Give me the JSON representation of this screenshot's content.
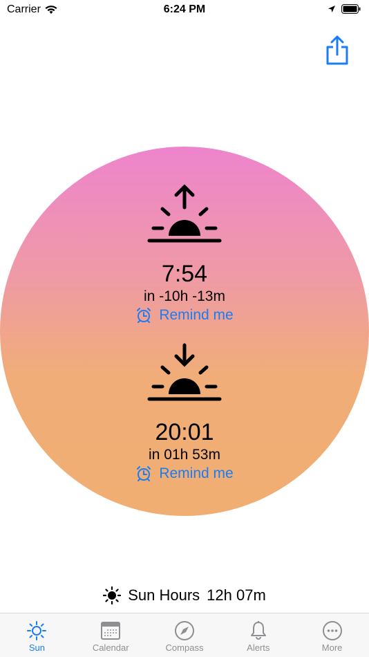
{
  "status": {
    "carrier": "Carrier",
    "time": "6:24 PM"
  },
  "sunrise": {
    "time": "7:54",
    "relative": "in -10h -13m",
    "remind_label": "Remind me"
  },
  "sunset": {
    "time": "20:01",
    "relative": "in 01h 53m",
    "remind_label": "Remind me"
  },
  "sun_hours": {
    "label": "Sun Hours",
    "value": "12h 07m"
  },
  "tabs": [
    {
      "label": "Sun",
      "icon": "sun-icon",
      "active": true
    },
    {
      "label": "Calendar",
      "icon": "calendar-icon"
    },
    {
      "label": "Compass",
      "icon": "compass-icon"
    },
    {
      "label": "Alerts",
      "icon": "bell-icon"
    },
    {
      "label": "More",
      "icon": "more-icon"
    }
  ],
  "colors": {
    "accent": "#1a7cf5",
    "gradient_top": "#ee84cd",
    "gradient_bottom": "#f0ae72"
  }
}
